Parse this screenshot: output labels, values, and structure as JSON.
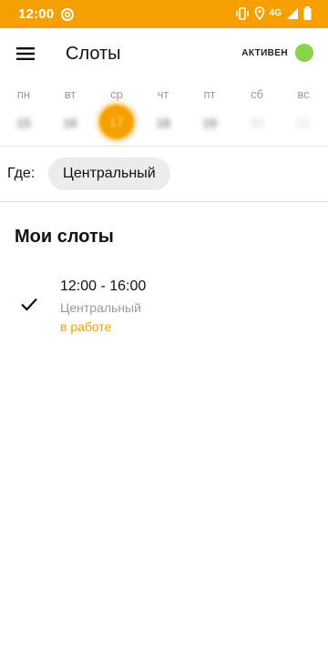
{
  "status_bar": {
    "time": "12:00",
    "network": "4G"
  },
  "app_bar": {
    "title": "Слоты",
    "status_label": "АКТИВЕН",
    "status_color": "#8bd14b"
  },
  "week": {
    "days": [
      {
        "name": "пн",
        "num": "15"
      },
      {
        "name": "вт",
        "num": "16"
      },
      {
        "name": "ср",
        "num": "17",
        "selected": true
      },
      {
        "name": "чт",
        "num": "18"
      },
      {
        "name": "пт",
        "num": "19"
      },
      {
        "name": "сб",
        "num": "20"
      },
      {
        "name": "вс",
        "num": "21"
      }
    ]
  },
  "filter": {
    "where_label": "Где:",
    "place": "Центральный"
  },
  "my_slots": {
    "title": "Мои слоты",
    "items": [
      {
        "time": "12:00 - 16:00",
        "place": "Центральный",
        "status": "в работе"
      }
    ]
  },
  "colors": {
    "accent": "#f5a000",
    "active": "#8bd14b"
  }
}
